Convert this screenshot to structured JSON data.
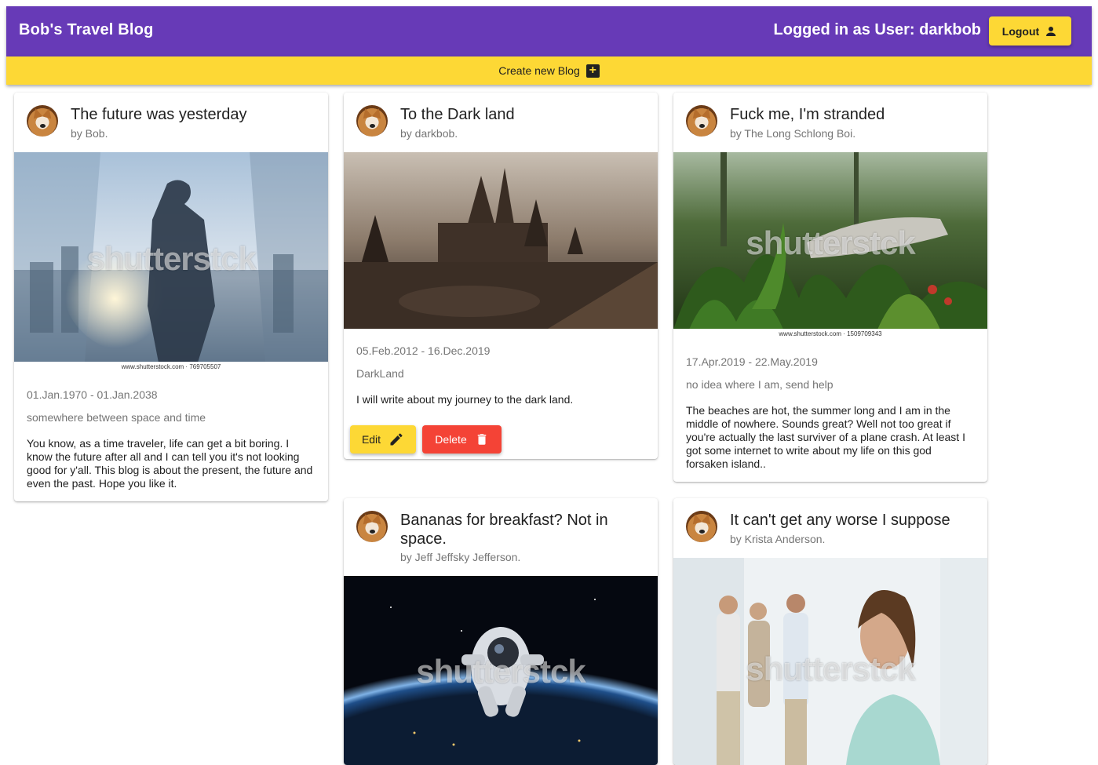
{
  "app": {
    "title": "Bob's Travel Blog",
    "user_label": "Logged in as User: darkbob",
    "logout_label": "Logout"
  },
  "toolbar": {
    "create_label": "Create new Blog"
  },
  "cards": [
    {
      "title": "The future was yesterday",
      "author": "by Bob.",
      "watermark": "shutterstck",
      "image_caption": "www.shutterstock.com · 769705507",
      "dates": "01.Jan.1970 - 01.Jan.2038",
      "location": "somewhere between space and time",
      "description": "You know, as a time traveler, life can get a bit boring. I know the future after all and I can tell you it's not looking good for y'all. This blog is about the present, the future and even the past. Hope you like it."
    },
    {
      "title": "To the Dark land",
      "author": "by darkbob.",
      "dates": "05.Feb.2012 - 16.Dec.2019",
      "location": "DarkLand",
      "description": "I will write about my journey to the dark land.",
      "edit_label": "Edit",
      "delete_label": "Delete"
    },
    {
      "title": "Fuck me, I'm stranded",
      "author": "by The Long Schlong Boi.",
      "watermark": "shutterstck",
      "image_caption": "www.shutterstock.com · 1509709343",
      "dates": "17.Apr.2019 - 22.May.2019",
      "location": "no idea where I am, send help",
      "description": "The beaches are hot, the summer long and I am in the middle of nowhere. Sounds great? Well not too great if you're actually the last surviver of a plane crash. At least I got some internet to write about my life on this god forsaken island.."
    },
    {
      "title": "Bananas for breakfast? Not in space.",
      "author": "by Jeff Jeffsky Jefferson.",
      "watermark": "shutterstck"
    },
    {
      "title": "It can't get any worse I suppose",
      "author": "by Krista Anderson.",
      "watermark": "shutterstck"
    }
  ],
  "colors": {
    "primary": "#673ab7",
    "accent": "#fdd835",
    "danger": "#f44336"
  }
}
